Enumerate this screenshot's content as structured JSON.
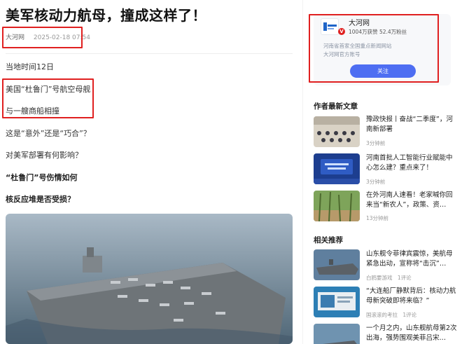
{
  "article": {
    "title": "美军核动力航母，撞成这样了！",
    "source": "大河网",
    "datetime": "2025-02-18 07:54",
    "paragraphs": [
      "当地时间12日",
      "美国“杜鲁门”号航空母舰",
      "与一艘商船相撞",
      "这是“意外”还是“巧合”？",
      "对美军部署有何影响？"
    ],
    "subheadings": [
      "“杜鲁门”号伤情如何",
      "核反应堆是否受损？"
    ]
  },
  "author_card": {
    "name": "大河网",
    "stats": "1004万获赞 52.4万粉丝",
    "desc_lines": [
      "河南省首家全国重点新闻网站",
      "大河网官方账号"
    ],
    "follow_label": "关注",
    "verified_mark": "V",
    "accent_color": "#4e6ef2"
  },
  "latest": {
    "heading": "作者最新文章",
    "items": [
      {
        "title": "豫政快报丨奋战“二季度”，河南新部署",
        "meta": "3分钟前"
      },
      {
        "title": "河南首批人工智能行业赋能中心怎么建？重点来了！",
        "meta": "3分钟前"
      },
      {
        "title": "在外河南人速看！老家喊你回来当“新农人”，政策、资…",
        "meta": "13分钟前"
      }
    ]
  },
  "related": {
    "heading": "相关推荐",
    "items": [
      {
        "title": "山东舰令菲律宾震惊，美航母紧急出动，宣称将“击沉”…",
        "source": "白鸥要游戏",
        "comments": "1评论"
      },
      {
        "title": "“大连船厂静默背后：核动力航母新突破即将来临？”",
        "source": "国滚滚的考拉",
        "comments": "1评论"
      },
      {
        "title": "一个月之内，山东舰航母第2次出海，强势围观美菲吕宋…",
        "source": "",
        "comments": ""
      }
    ]
  },
  "highlight_color": "#e02020"
}
